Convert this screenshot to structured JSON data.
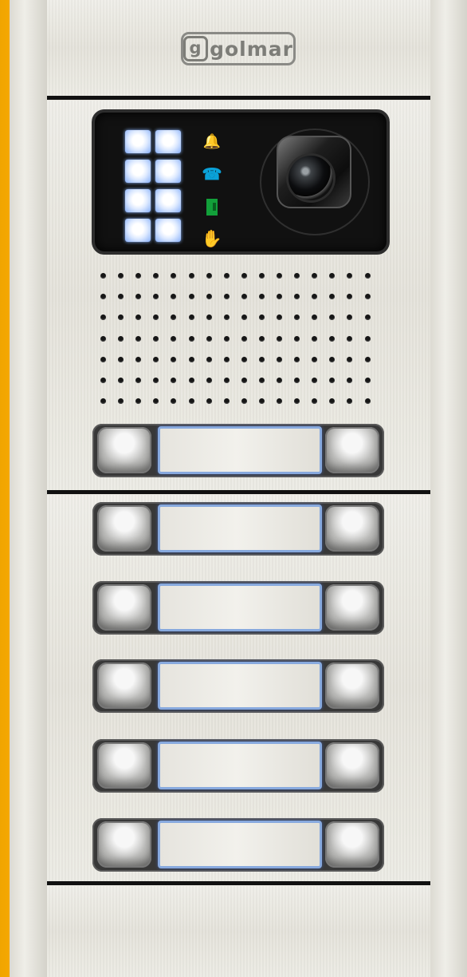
{
  "brand": {
    "logo_text": "golmar"
  },
  "keypad": {
    "keys": [
      "",
      "",
      "",
      "",
      "",
      "",
      "",
      ""
    ]
  },
  "status_icons": [
    {
      "name": "bell-icon",
      "color": "#ff8b00"
    },
    {
      "name": "phone-icon",
      "color": "#0aa1d8"
    },
    {
      "name": "door-icon",
      "color": "#12a03a"
    },
    {
      "name": "hand-stop-icon",
      "color": "#e91d20"
    }
  ],
  "buttons": [
    {
      "left_label": "",
      "name_label": "",
      "right_label": ""
    },
    {
      "left_label": "",
      "name_label": "",
      "right_label": ""
    },
    {
      "left_label": "",
      "name_label": "",
      "right_label": ""
    },
    {
      "left_label": "",
      "name_label": "",
      "right_label": ""
    },
    {
      "left_label": "",
      "name_label": "",
      "right_label": ""
    },
    {
      "left_label": "",
      "name_label": "",
      "right_label": ""
    }
  ],
  "colors": {
    "accent": "#f5a400",
    "panel": "#e8e6df",
    "seam": "#111111"
  }
}
